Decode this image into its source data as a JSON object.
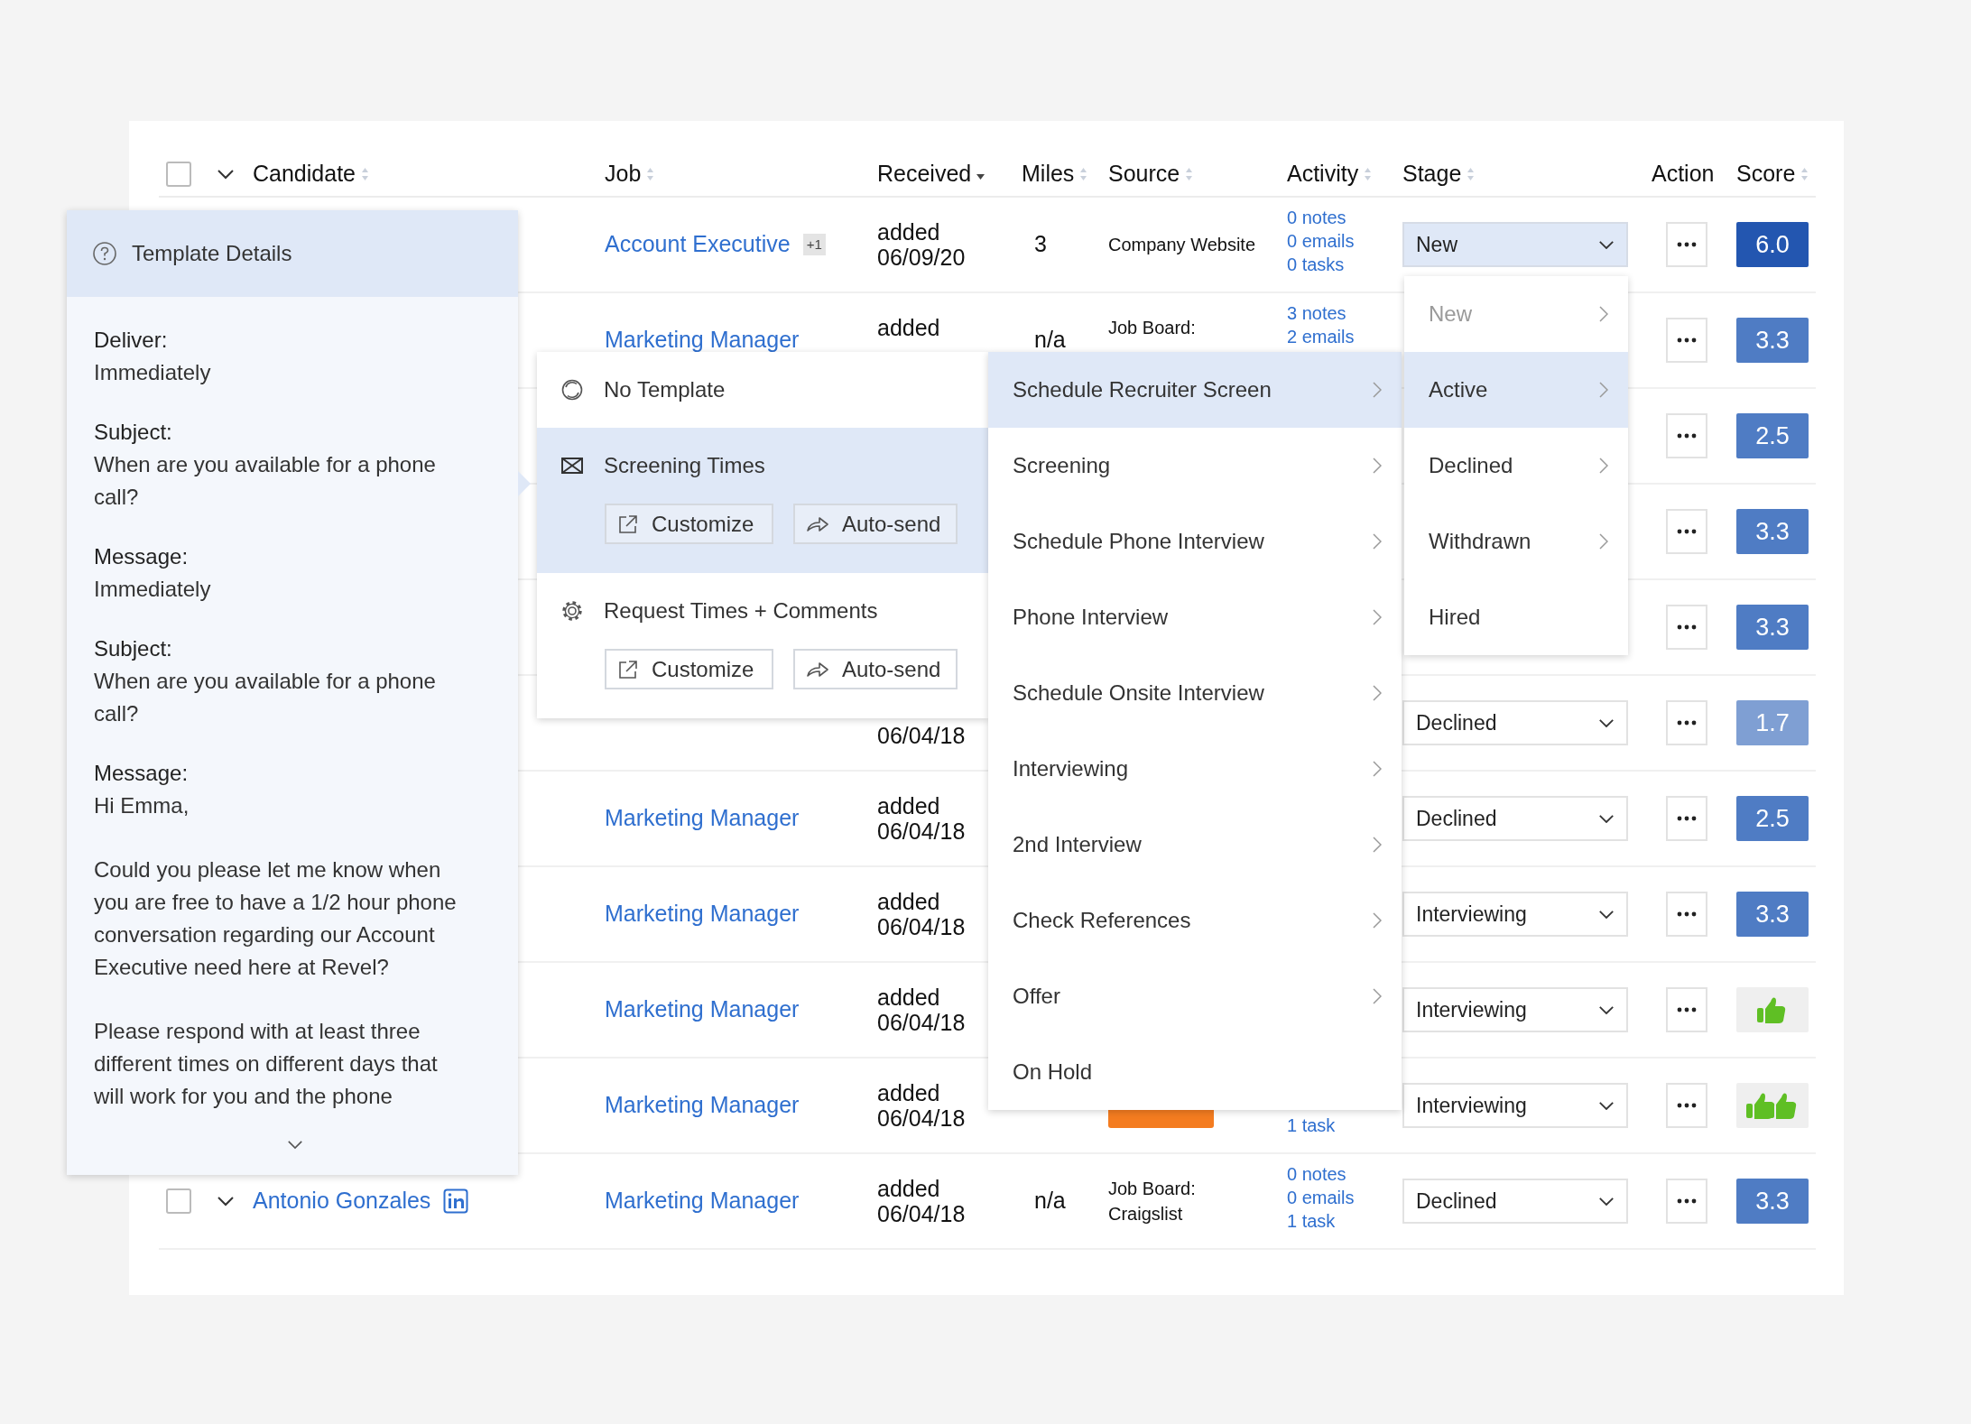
{
  "table": {
    "select_all": {
      "checked": false
    },
    "columns": [
      {
        "label": "Candidate",
        "sortable": true,
        "sorted": false
      },
      {
        "label": "Job",
        "sortable": true,
        "sorted": false
      },
      {
        "label": "Received",
        "sortable": true,
        "sorted": true
      },
      {
        "label": "Miles",
        "sortable": true,
        "sorted": false
      },
      {
        "label": "Source",
        "sortable": true,
        "sorted": false
      },
      {
        "label": "Activity",
        "sortable": true,
        "sorted": false
      },
      {
        "label": "Stage",
        "sortable": true,
        "sorted": false
      },
      {
        "label": "Action",
        "sortable": false
      },
      {
        "label": "Score",
        "sortable": true,
        "sorted": false
      }
    ],
    "rows": [
      {
        "job": "Account Executive",
        "job_extra": "+1",
        "received": {
          "label": "added",
          "date": "06/09/20"
        },
        "miles": "3",
        "source": {
          "name": "Company Website"
        },
        "activity": {
          "notes": "0 notes",
          "emails": "0 emails",
          "tasks": "0 tasks"
        },
        "stage": {
          "value": "New",
          "open": true
        },
        "score": {
          "kind": "number",
          "value": "6.0",
          "color": "#2356b0"
        }
      },
      {
        "job": "Marketing Manager",
        "received": {
          "label": "added"
        },
        "miles": "n/a",
        "source": {
          "board": "Job Board:"
        },
        "activity": {
          "notes": "3 notes",
          "emails": "2 emails"
        },
        "score": {
          "kind": "number",
          "value": "3.3",
          "color": "#4f7cc4"
        }
      },
      {
        "score": {
          "kind": "number",
          "value": "2.5",
          "color": "#4f7cc4"
        }
      },
      {
        "score": {
          "kind": "number",
          "value": "3.3",
          "color": "#4f7cc4"
        }
      },
      {
        "score": {
          "kind": "number",
          "value": "3.3",
          "color": "#4f7cc4"
        }
      },
      {
        "received": {
          "date": "06/04/18"
        },
        "stage": {
          "value": "Declined",
          "open": false
        },
        "score": {
          "kind": "number",
          "value": "1.7",
          "color": "#7f9fd3"
        }
      },
      {
        "job": "Marketing Manager",
        "received": {
          "label": "added",
          "date": "06/04/18"
        },
        "stage": {
          "value": "Declined",
          "open": false
        },
        "score": {
          "kind": "number",
          "value": "2.5",
          "color": "#4f7cc4"
        }
      },
      {
        "job": "Marketing Manager",
        "received": {
          "label": "added",
          "date": "06/04/18"
        },
        "stage": {
          "value": "Interviewing",
          "open": false
        },
        "score": {
          "kind": "number",
          "value": "3.3",
          "color": "#4f7cc4"
        }
      },
      {
        "job": "Marketing Manager",
        "received": {
          "label": "added",
          "date": "06/04/18"
        },
        "stage": {
          "value": "Interviewing",
          "open": false
        },
        "score": {
          "kind": "thumb_up"
        }
      },
      {
        "job": "Marketing Manager",
        "received": {
          "label": "added",
          "date": "06/04/18"
        },
        "source_tag": true,
        "activity": {
          "tasks": "1 task"
        },
        "stage": {
          "value": "Interviewing",
          "open": false
        },
        "score": {
          "kind": "double_thumb_up"
        }
      },
      {
        "checked": false,
        "candidate": {
          "name": "Antonio Gonzales",
          "profile_badge": true
        },
        "job": "Marketing Manager",
        "received": {
          "label": "added",
          "date": "06/04/18"
        },
        "miles": "n/a",
        "source": {
          "board": "Job Board:",
          "site": "Craigslist"
        },
        "activity": {
          "notes": "0 notes",
          "emails": "0 emails",
          "tasks": "1 task"
        },
        "stage": {
          "value": "Declined",
          "open": false
        },
        "score": {
          "kind": "number",
          "value": "3.3",
          "color": "#4f7cc4"
        }
      }
    ]
  },
  "template_details": {
    "title": "Template Details",
    "fields": [
      {
        "label": "Deliver:",
        "value": [
          "Immediately"
        ]
      },
      {
        "label": "Subject:",
        "value": [
          "When are you available for a phone call?"
        ]
      },
      {
        "label": "Message:",
        "value": [
          "Immediately"
        ]
      },
      {
        "label": "Subject:",
        "value": [
          "When are you available for a phone call?"
        ]
      },
      {
        "label": "Message:",
        "value": [
          "Hi Emma,",
          "Could you please let me know when you are free to have a 1/2 hour phone conversation regarding our Account Executive need here at Revel?",
          "Please respond with at least three different times on different days that will work for you and the phone"
        ]
      }
    ]
  },
  "template_menu": {
    "items": [
      {
        "kind": "none",
        "label": "No Template",
        "selected": false
      },
      {
        "kind": "email",
        "label": "Screening Times",
        "selected": true,
        "actions": [
          "Customize",
          "Auto-send"
        ]
      },
      {
        "kind": "settings",
        "label": "Request Times + Comments",
        "selected": false,
        "actions": [
          "Customize",
          "Auto-send"
        ]
      }
    ]
  },
  "stage_submenu": {
    "items": [
      {
        "label": "Schedule Recruiter Screen",
        "selected": true,
        "has_submenu": true
      },
      {
        "label": "Screening",
        "selected": false,
        "has_submenu": true
      },
      {
        "label": "Schedule Phone Interview",
        "selected": false,
        "has_submenu": true
      },
      {
        "label": "Phone Interview",
        "selected": false,
        "has_submenu": true
      },
      {
        "label": "Schedule Onsite Interview",
        "selected": false,
        "has_submenu": true
      },
      {
        "label": "Interviewing",
        "selected": false,
        "has_submenu": true
      },
      {
        "label": "2nd Interview",
        "selected": false,
        "has_submenu": true
      },
      {
        "label": "Check References",
        "selected": false,
        "has_submenu": true
      },
      {
        "label": "Offer",
        "selected": false,
        "has_submenu": true
      },
      {
        "label": "On Hold",
        "selected": false,
        "has_submenu": false
      }
    ]
  },
  "stage_list": {
    "items": [
      {
        "label": "New",
        "selected": false,
        "disabled": true,
        "has_submenu": true
      },
      {
        "label": "Active",
        "selected": true,
        "disabled": false,
        "has_submenu": true
      },
      {
        "label": "Declined",
        "selected": false,
        "disabled": false,
        "has_submenu": true
      },
      {
        "label": "Withdrawn",
        "selected": false,
        "disabled": false,
        "has_submenu": true
      },
      {
        "label": "Hired",
        "selected": false,
        "disabled": false,
        "has_submenu": false
      }
    ]
  }
}
